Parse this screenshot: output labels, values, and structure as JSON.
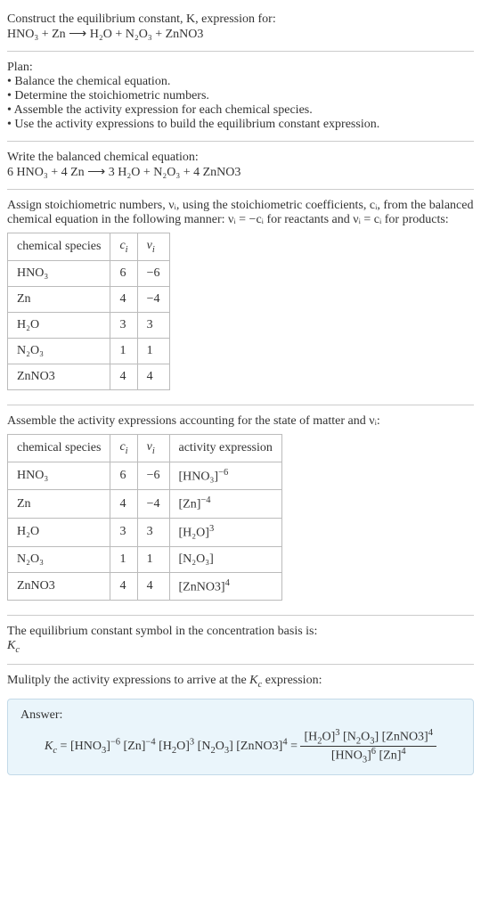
{
  "prompt": {
    "line1": "Construct the equilibrium constant, K, expression for:",
    "equation": "HNO₃ + Zn ⟶ H₂O + N₂O₃ + ZnNO3"
  },
  "plan": {
    "heading": "Plan:",
    "items": [
      "• Balance the chemical equation.",
      "• Determine the stoichiometric numbers.",
      "• Assemble the activity expression for each chemical species.",
      "• Use the activity expressions to build the equilibrium constant expression."
    ]
  },
  "balanced": {
    "heading": "Write the balanced chemical equation:",
    "equation": "6 HNO₃ + 4 Zn ⟶ 3 H₂O + N₂O₃ + 4 ZnNO3"
  },
  "stoich_intro": "Assign stoichiometric numbers, νᵢ, using the stoichiometric coefficients, cᵢ, from the balanced chemical equation in the following manner: νᵢ = −cᵢ for reactants and νᵢ = cᵢ for products:",
  "table1": {
    "headers": [
      "chemical species",
      "cᵢ",
      "νᵢ"
    ],
    "rows": [
      [
        "HNO₃",
        "6",
        "−6"
      ],
      [
        "Zn",
        "4",
        "−4"
      ],
      [
        "H₂O",
        "3",
        "3"
      ],
      [
        "N₂O₃",
        "1",
        "1"
      ],
      [
        "ZnNO3",
        "4",
        "4"
      ]
    ]
  },
  "activity_intro": "Assemble the activity expressions accounting for the state of matter and νᵢ:",
  "table2": {
    "headers": [
      "chemical species",
      "cᵢ",
      "νᵢ",
      "activity expression"
    ],
    "rows": [
      {
        "sp": "HNO₃",
        "c": "6",
        "v": "−6",
        "expr_base": "[HNO₃]",
        "expr_exp": "−6"
      },
      {
        "sp": "Zn",
        "c": "4",
        "v": "−4",
        "expr_base": "[Zn]",
        "expr_exp": "−4"
      },
      {
        "sp": "H₂O",
        "c": "3",
        "v": "3",
        "expr_base": "[H₂O]",
        "expr_exp": "3"
      },
      {
        "sp": "N₂O₃",
        "c": "1",
        "v": "1",
        "expr_base": "[N₂O₃]",
        "expr_exp": ""
      },
      {
        "sp": "ZnNO3",
        "c": "4",
        "v": "4",
        "expr_base": "[ZnNO3]",
        "expr_exp": "4"
      }
    ]
  },
  "kc_symbol": {
    "line": "The equilibrium constant symbol in the concentration basis is:",
    "sym": "K_c"
  },
  "multiply_line": "Mulitply the activity expressions to arrive at the K_c expression:",
  "answer": {
    "label": "Answer:",
    "lhs": "K_c = [HNO₃]⁻⁶ [Zn]⁻⁴ [H₂O]³ [N₂O₃] [ZnNO3]⁴ =",
    "num": "[H₂O]³ [N₂O₃] [ZnNO3]⁴",
    "den": "[HNO₃]⁶ [Zn]⁴"
  },
  "chart_data": {
    "type": "table",
    "title": "Stoichiometric numbers and activity expressions",
    "stoichiometric_table": {
      "columns": [
        "chemical species",
        "c_i",
        "nu_i"
      ],
      "rows": [
        [
          "HNO3",
          6,
          -6
        ],
        [
          "Zn",
          4,
          -4
        ],
        [
          "H2O",
          3,
          3
        ],
        [
          "N2O3",
          1,
          1
        ],
        [
          "ZnNO3",
          4,
          4
        ]
      ]
    },
    "activity_table": {
      "columns": [
        "chemical species",
        "c_i",
        "nu_i",
        "activity expression"
      ],
      "rows": [
        [
          "HNO3",
          6,
          -6,
          "[HNO3]^-6"
        ],
        [
          "Zn",
          4,
          -4,
          "[Zn]^-4"
        ],
        [
          "H2O",
          3,
          3,
          "[H2O]^3"
        ],
        [
          "N2O3",
          1,
          1,
          "[N2O3]"
        ],
        [
          "ZnNO3",
          4,
          4,
          "[ZnNO3]^4"
        ]
      ]
    },
    "balanced_equation": "6 HNO3 + 4 Zn -> 3 H2O + N2O3 + 4 ZnNO3",
    "Kc_expression": "([H2O]^3 [N2O3] [ZnNO3]^4) / ([HNO3]^6 [Zn]^4)"
  }
}
